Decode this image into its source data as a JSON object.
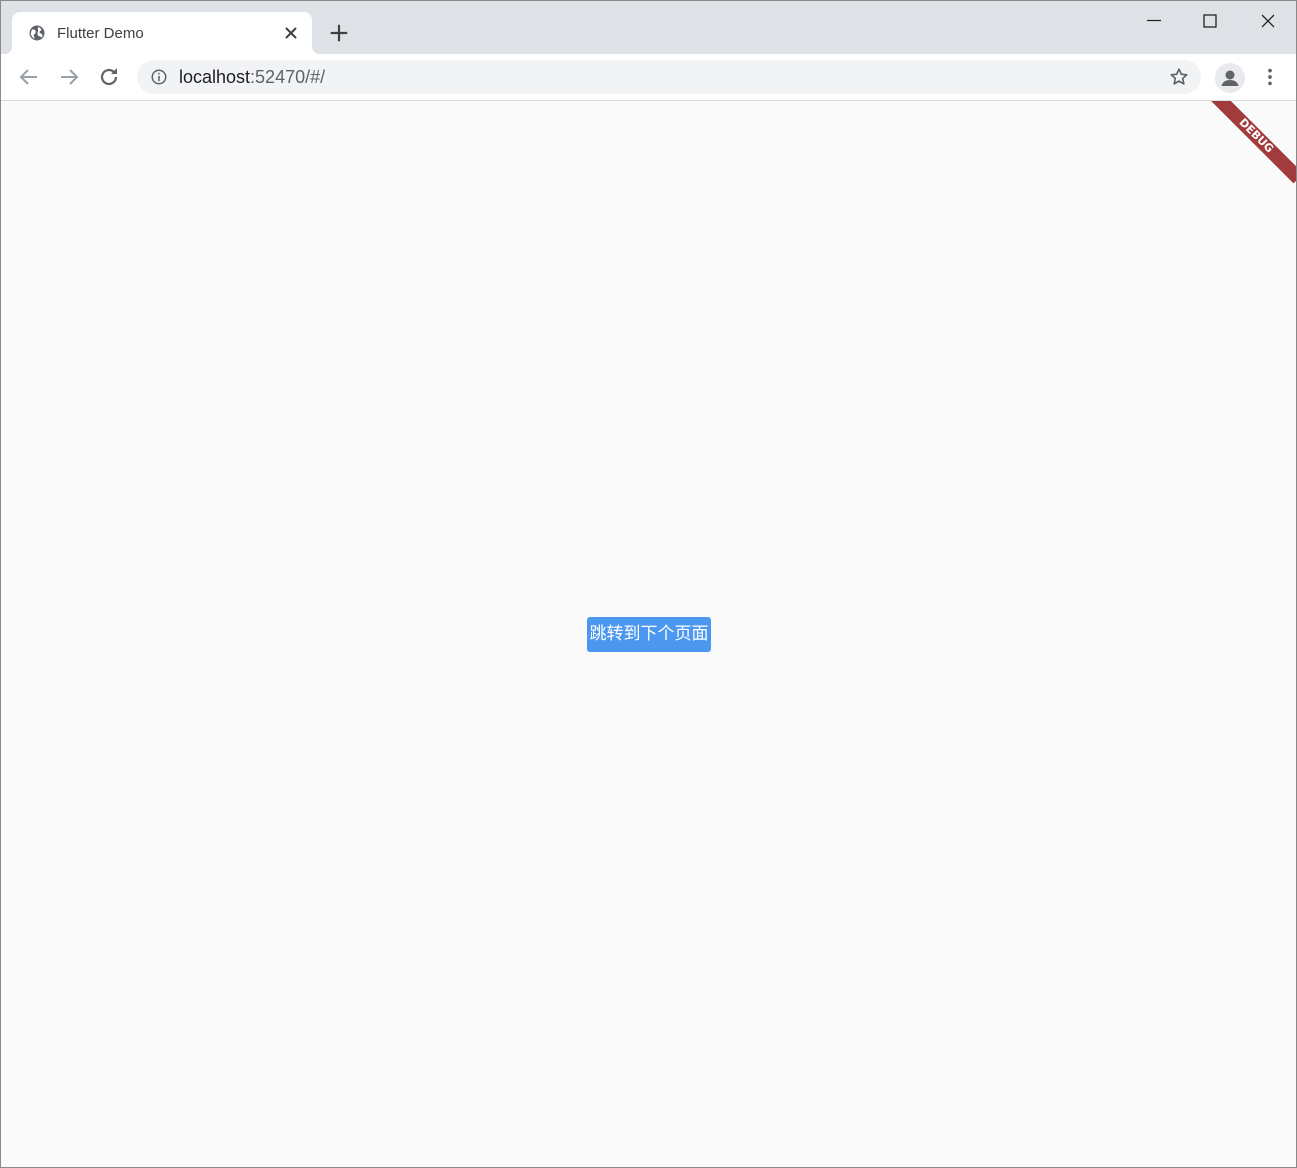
{
  "browser": {
    "tab": {
      "title": "Flutter Demo",
      "favicon": "globe-icon"
    },
    "address_bar": {
      "host": "localhost",
      "rest": ":52470/#/"
    }
  },
  "page": {
    "debug_banner": "DEBUG",
    "button_label": "跳转到下个页面"
  },
  "colors": {
    "button": "#4c97ef",
    "banner": "#a23b3b",
    "page_bg": "#fafafa",
    "tabstrip_bg": "#dee1e6"
  }
}
